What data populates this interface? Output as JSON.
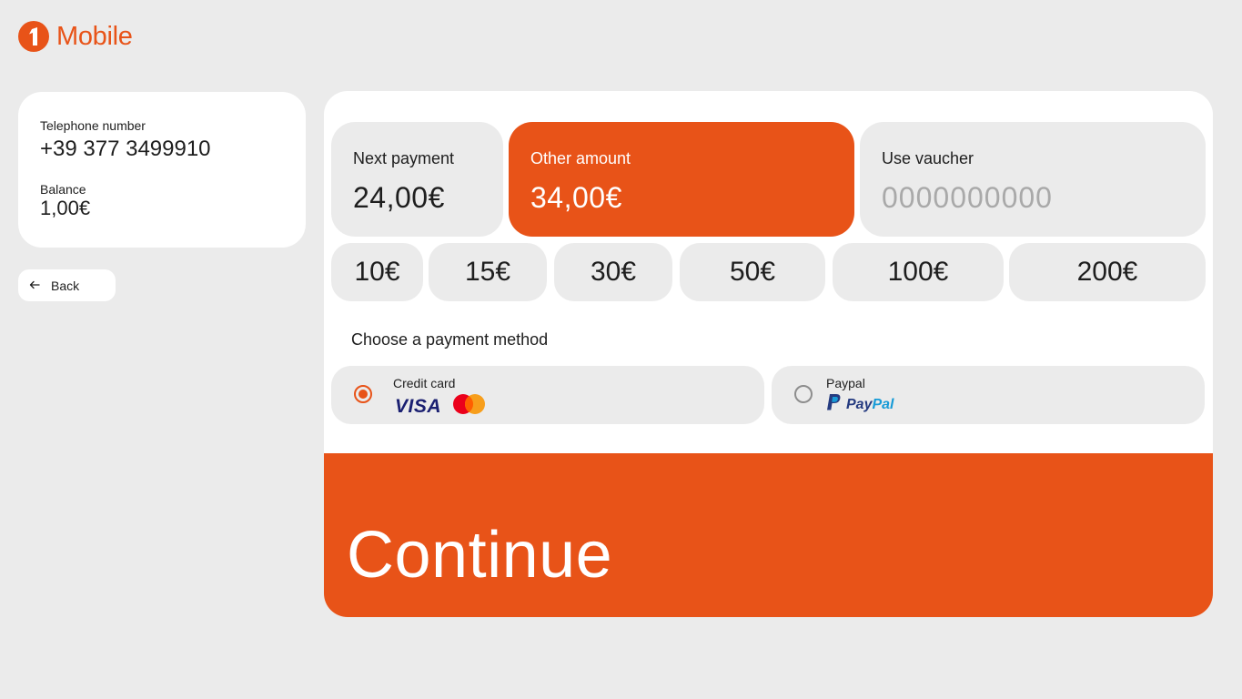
{
  "brand": {
    "name": "Mobile",
    "mark_digit": "1",
    "accent_color": "#e85318"
  },
  "account": {
    "phone_label": "Telephone number",
    "phone_value": "+39 377 3499910",
    "balance_label": "Balance",
    "balance_value": "1,00€"
  },
  "back": {
    "icon": "arrow-left-icon",
    "label": "Back"
  },
  "amount_options": {
    "next_payment": {
      "label": "Next payment",
      "value": "24,00€"
    },
    "other_amount": {
      "label": "Other amount",
      "value": "34,00€",
      "selected": true
    },
    "voucher": {
      "label": "Use vaucher",
      "value": "",
      "placeholder": "0000000000"
    }
  },
  "quick_amounts": [
    "10€",
    "15€",
    "30€",
    "50€",
    "100€",
    "200€"
  ],
  "payment": {
    "title": "Choose a payment method",
    "methods": [
      {
        "label": "Credit card",
        "logos": [
          "visa-logo",
          "mastercard-logo"
        ],
        "logo_text": "VISA",
        "selected": true
      },
      {
        "label": "Paypal",
        "logos": [
          "paypal-logo"
        ],
        "logo_text_pay": "Pay",
        "logo_text_pal": "Pal",
        "selected": false
      }
    ]
  },
  "continue_label": "Continue"
}
